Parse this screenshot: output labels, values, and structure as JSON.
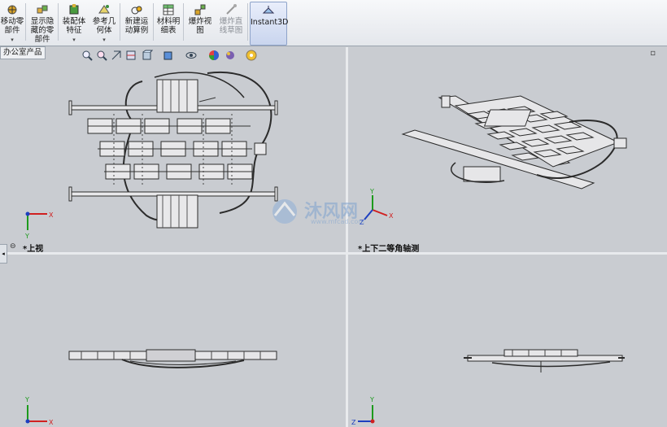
{
  "toolbar": {
    "buttons": [
      {
        "label": "移动零\n部件"
      },
      {
        "label": "显示隐\n藏的零\n部件"
      },
      {
        "label": "装配体\n特征"
      },
      {
        "label": "参考几\n何体"
      },
      {
        "label": "新建运\n动算例"
      },
      {
        "label": "材料明\n细表"
      },
      {
        "label": "爆炸视\n图"
      },
      {
        "label": "爆炸直\n线草图"
      },
      {
        "label": "Instant3D"
      }
    ]
  },
  "tab": {
    "label": "办公室产品"
  },
  "views": {
    "top_left": "*上视",
    "top_right": "*上下二等角轴测",
    "bottom_left": "",
    "bottom_right": ""
  },
  "watermark": {
    "text": "沐风网",
    "url": "www.mfcad.com"
  },
  "triad": {
    "x": "X",
    "y": "Y",
    "z": "Z"
  },
  "colors": {
    "triad_x": "#d02020",
    "triad_y": "#1c9a1c",
    "triad_z": "#1d3fbf",
    "accent": "#3a5fae"
  }
}
